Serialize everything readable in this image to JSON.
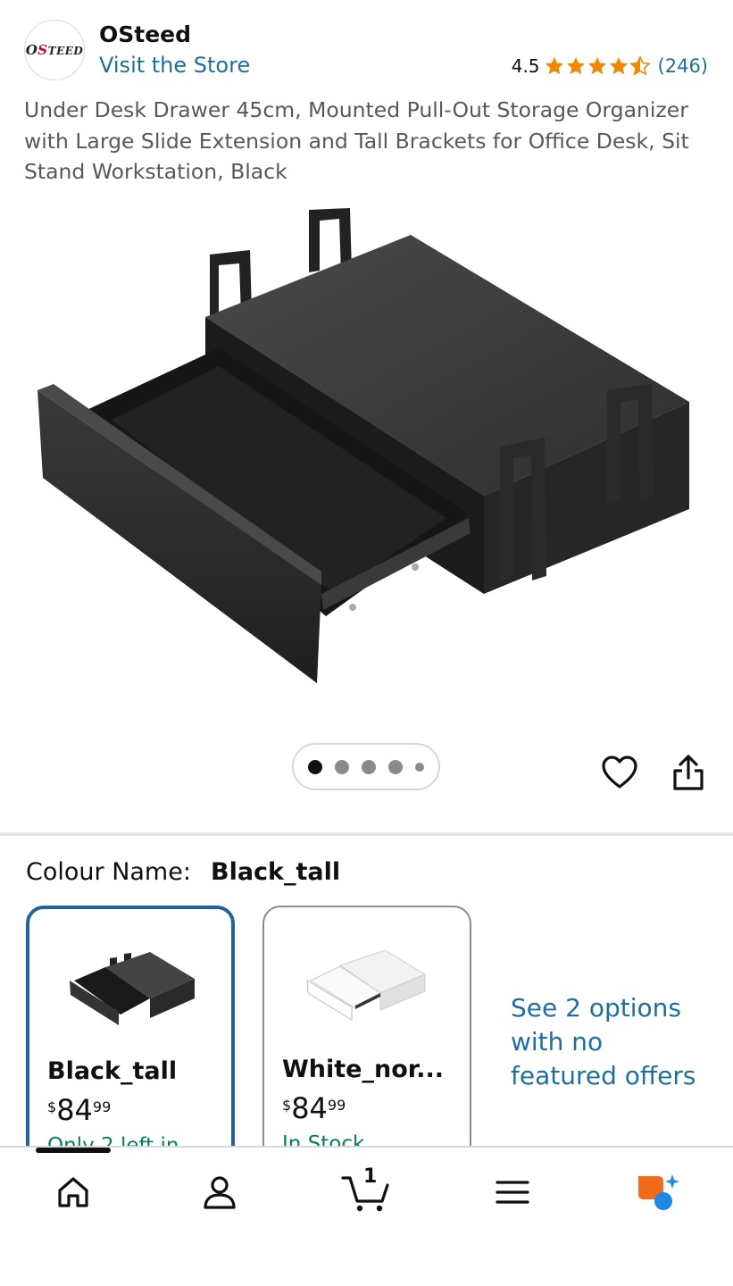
{
  "header": {
    "brand_logo_text": "OSteed",
    "brand_name": "OSteed",
    "visit_store": "Visit the Store",
    "rating": "4.5",
    "rating_stars": 4.5,
    "rating_count": "(246)",
    "star_color": "#f08804"
  },
  "product": {
    "title": "Under Desk Drawer 45cm, Mounted Pull-Out Storage Organizer with Large Slide Extension and Tall Brackets for Office Desk, Sit Stand Workstation, Black",
    "image_dots": 5,
    "active_image_index": 0
  },
  "actions": {
    "wishlist_icon": "heart-icon",
    "share_icon": "share-icon"
  },
  "colour": {
    "label": "Colour Name:",
    "selected": "Black_tall"
  },
  "variants": [
    {
      "name": "Black_tall",
      "price_symbol": "$",
      "price_whole": "84",
      "price_fraction": "99",
      "stock": "Only 2 left in"
    },
    {
      "name": "White_nor...",
      "price_symbol": "$",
      "price_whole": "84",
      "price_fraction": "99",
      "stock": "In Stock"
    }
  ],
  "see_options": "See 2 options with no featured offers",
  "bottom_nav": {
    "items": [
      "home-icon",
      "account-icon",
      "cart-icon",
      "menu-icon",
      "rufus-icon"
    ],
    "cart_count": "1"
  },
  "colors": {
    "link": "#1f6f9e",
    "selected_border": "#2162a1",
    "stock_green": "#067d62",
    "rufus_orange": "#f26b1d",
    "rufus_blue": "#1e88e5"
  }
}
